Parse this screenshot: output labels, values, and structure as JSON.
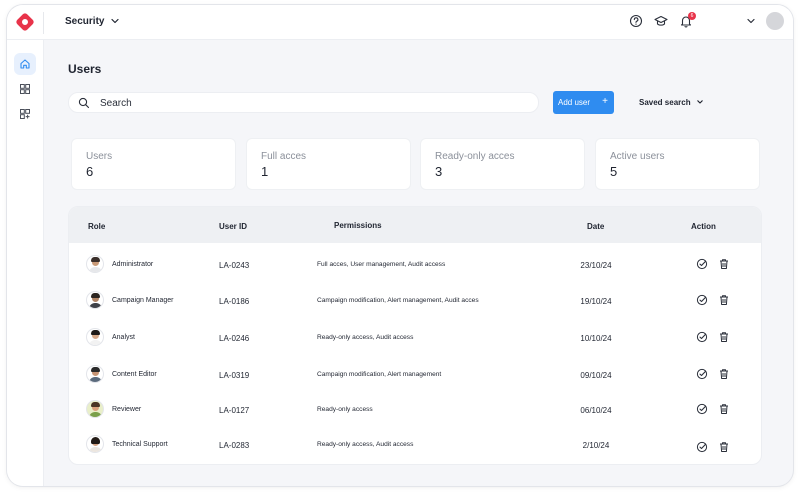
{
  "app": {
    "section_title": "Security",
    "notification_count": "6"
  },
  "page": {
    "title": "Users"
  },
  "search": {
    "placeholder": "Search",
    "value": ""
  },
  "toolbar": {
    "add_user_label": "Add user",
    "add_user_icon": "+",
    "saved_search_label": "Saved search"
  },
  "stats": [
    {
      "label": "Users",
      "value": "6"
    },
    {
      "label": "Full acces",
      "value": "1"
    },
    {
      "label": "Ready-only acces",
      "value": "3"
    },
    {
      "label": "Active users",
      "value": "5"
    }
  ],
  "table": {
    "columns": {
      "role": "Role",
      "user_id": "User ID",
      "permissions": "Permissions",
      "date": "Date",
      "action": "Action"
    },
    "rows": [
      {
        "role": "Administrator",
        "user_id": "LA-0243",
        "permissions": "Full acces, User management, Audit access",
        "date": "23/10/24"
      },
      {
        "role": "Campaign Manager",
        "user_id": "LA-0186",
        "permissions": "Campaign modification, Alert management, Audit acces",
        "date": "19/10/24"
      },
      {
        "role": "Analyst",
        "user_id": "LA-0246",
        "permissions": "Ready-only access, Audit access",
        "date": "10/10/24"
      },
      {
        "role": "Content Editor",
        "user_id": "LA-0319",
        "permissions": "Campaign modification, Alert management",
        "date": "09/10/24"
      },
      {
        "role": "Reviewer",
        "user_id": "LA-0127",
        "permissions": "Ready-only access",
        "date": "06/10/24"
      },
      {
        "role": "Technical Support",
        "user_id": "LA-0283",
        "permissions": "Ready-only access, Audit access",
        "date": "2/10/24"
      }
    ]
  },
  "colors": {
    "accent": "#2f8cf0",
    "brand": "#e8334a",
    "background": "#f5f6f9"
  },
  "icons": {
    "top": [
      "help-icon",
      "graduation-cap-icon",
      "bell-icon",
      "chevron-down-icon"
    ],
    "sidebar": [
      "home-icon",
      "dashboard-icon",
      "add-widget-icon"
    ],
    "row_actions": [
      "check-circle-icon",
      "trash-icon"
    ]
  }
}
